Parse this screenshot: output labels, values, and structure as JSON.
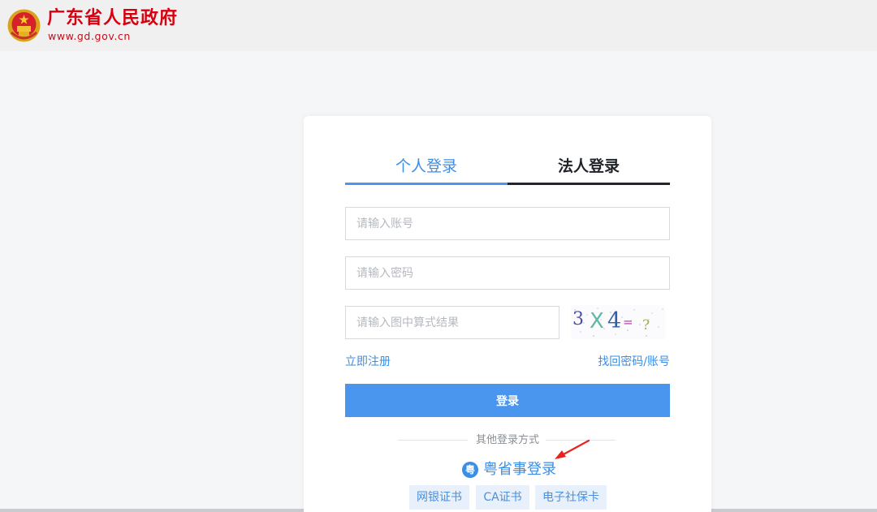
{
  "header": {
    "site_name": "广东省人民政府",
    "site_url": "www.gd.gov.cn",
    "emblem_icon": "national-emblem-icon"
  },
  "login": {
    "tabs": [
      {
        "label": "个人登录",
        "active": true
      },
      {
        "label": "法人登录",
        "active": false
      }
    ],
    "account_placeholder": "请输入账号",
    "password_placeholder": "请输入密码",
    "captcha_placeholder": "请输入图中算式结果",
    "captcha_text": "3 X 4 = ?",
    "register_link": "立即注册",
    "recover_link": "找回密码/账号",
    "submit_label": "登录",
    "other_methods_label": "其他登录方式",
    "yss_icon_glyph": "粤",
    "yss_label": "粤省事登录",
    "alt_methods": [
      "网银证书",
      "CA证书",
      "电子社保卡"
    ]
  },
  "colors": {
    "accent": "#4a95ee",
    "brand_red": "#d7000f",
    "annotation_arrow": "#e8231e"
  }
}
